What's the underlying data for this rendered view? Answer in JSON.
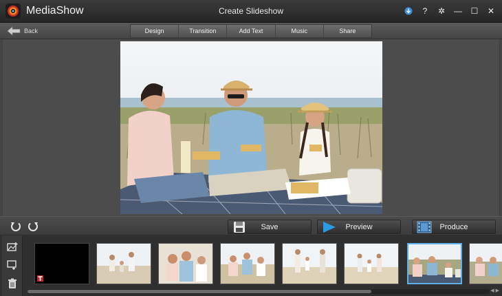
{
  "app": {
    "name": "MediaShow",
    "window_title": "Create Slideshow"
  },
  "titlebar": {
    "icons": [
      "update-icon",
      "help-icon",
      "settings-icon",
      "minimize-icon",
      "maximize-icon",
      "close-icon"
    ],
    "help_glyph": "?",
    "settings_glyph": "✲",
    "minimize_glyph": "—",
    "maximize_glyph": "☐",
    "close_glyph": "✕"
  },
  "toolbar": {
    "back_label": "Back",
    "tabs": [
      {
        "label": "Design"
      },
      {
        "label": "Transition"
      },
      {
        "label": "Add Text"
      },
      {
        "label": "Music"
      },
      {
        "label": "Share"
      }
    ]
  },
  "actions": {
    "save_label": "Save",
    "preview_label": "Preview",
    "produce_label": "Produce"
  },
  "filmstrip": {
    "thumbnails": [
      {
        "kind": "title-slide",
        "badge": "T"
      },
      {
        "kind": "photo"
      },
      {
        "kind": "photo"
      },
      {
        "kind": "photo"
      },
      {
        "kind": "photo"
      },
      {
        "kind": "photo"
      },
      {
        "kind": "photo",
        "selected": true
      },
      {
        "kind": "photo"
      }
    ]
  },
  "colors": {
    "accent": "#5fb0e8",
    "preview_arrow": "#2a9be0"
  }
}
